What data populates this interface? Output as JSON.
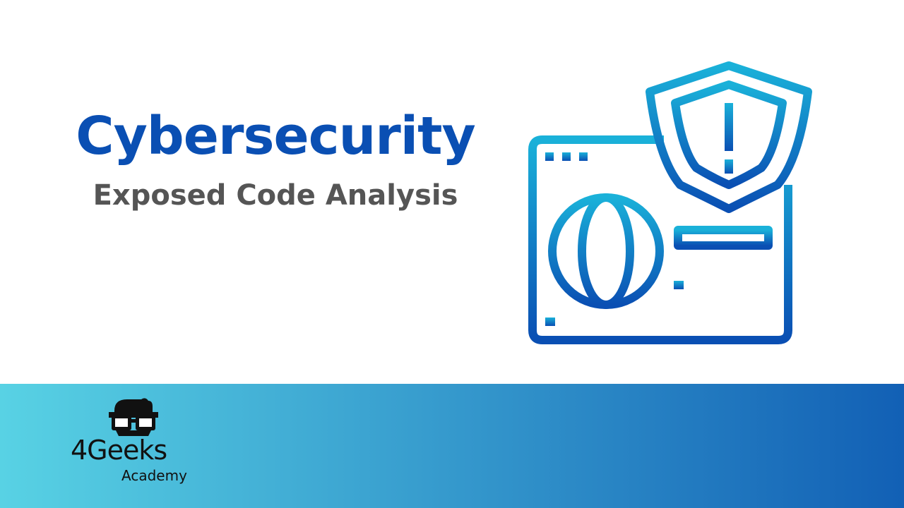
{
  "slide": {
    "title": "Cybersecurity",
    "subtitle": "Exposed Code Analysis"
  },
  "illustration": {
    "icon": "browser-shield-globe-icon",
    "gradient_top": "#1ab1d9",
    "gradient_bottom": "#0a4fb3"
  },
  "footer": {
    "gradient_left": "#58d2e4",
    "gradient_right": "#1260b5"
  },
  "logo": {
    "main": "4Geeks",
    "sub": "Academy",
    "icon": "geek-mascot-icon"
  },
  "colors": {
    "title": "#0a4fb3",
    "subtitle": "#555555"
  }
}
